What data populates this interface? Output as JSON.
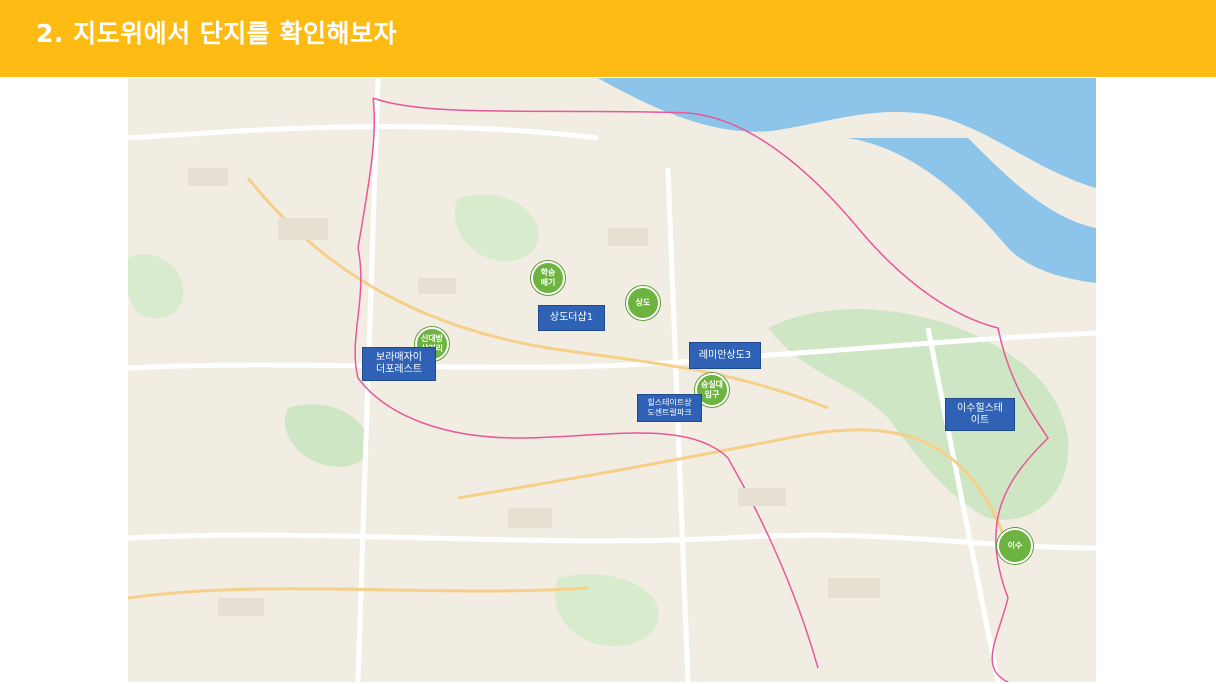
{
  "header": {
    "title": "2. 지도위에서 단지를 확인해보자"
  },
  "stations": [
    {
      "id": "hakseungbaegi",
      "label": "학숭\n배기"
    },
    {
      "id": "sangdo",
      "label": "상도"
    },
    {
      "id": "sindaebang",
      "label": "신대방\n삼거리"
    },
    {
      "id": "soongsil",
      "label": "숭실대\n입구"
    },
    {
      "id": "isu",
      "label": "이수"
    }
  ],
  "complexes": [
    {
      "id": "sangdo-the-sharp-1",
      "label": "상도더샵1"
    },
    {
      "id": "raemian-sangdo-3",
      "label": "레미안상도3"
    },
    {
      "id": "boramae-xi",
      "label": "보라매자이\n더포레스트"
    },
    {
      "id": "hillstate-sangdo",
      "label": "힐스테이트상\n도센트럴파크"
    },
    {
      "id": "isu-hillstate",
      "label": "이수힐스테\n이트"
    }
  ],
  "colors": {
    "header": "#fdbb13",
    "river": "#8cc4ea",
    "park": "#cfe6c4",
    "station": "#6db33f",
    "complex": "#2f62b4",
    "boundary": "#e8589a"
  }
}
